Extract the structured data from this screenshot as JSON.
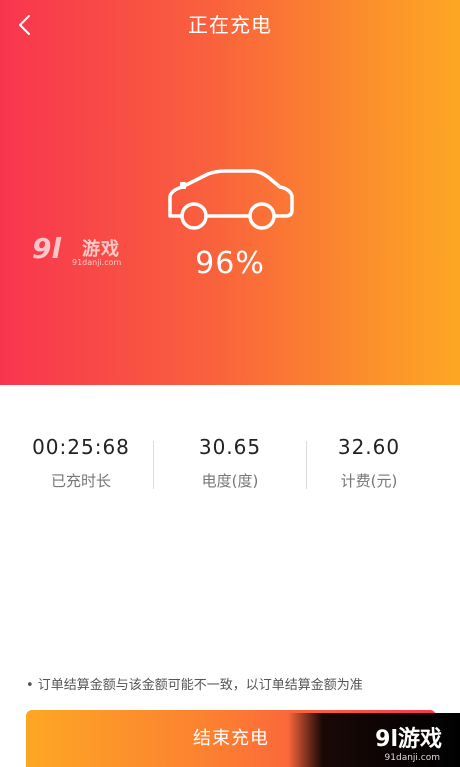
{
  "header": {
    "title": "正在充电",
    "back_icon": "chevron-left-icon"
  },
  "charging": {
    "icon": "car-icon",
    "battery_percent": "96%"
  },
  "stats": [
    {
      "value": "00:25:68",
      "label": "已充时长"
    },
    {
      "value": "30.65",
      "label": "电度(度)"
    },
    {
      "value": "32.60",
      "label": "计费(元)"
    }
  ],
  "notice": "• 订单结算金额与该金额可能不一致，以订单结算金额为准",
  "footer": {
    "end_button_label": "结束充电"
  },
  "watermarks": {
    "left_logo": "9l",
    "left_brand": "游戏",
    "left_url": "91danji.com",
    "corner_text": "9l游戏",
    "corner_url": "91danji.com"
  },
  "colors": {
    "gradient_start": "#f8354f",
    "gradient_end": "#fda724",
    "text_primary": "#222222",
    "text_secondary": "#777777"
  }
}
